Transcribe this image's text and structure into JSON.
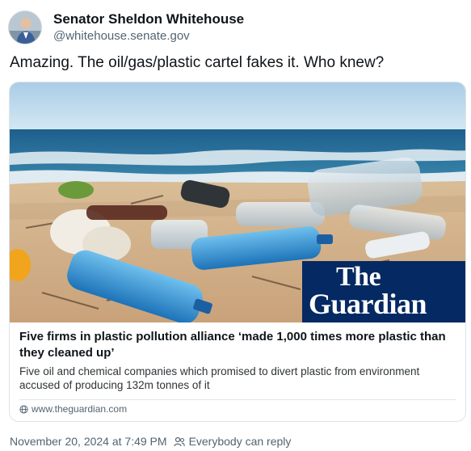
{
  "author": {
    "name": "Senator Sheldon Whitehouse",
    "handle": "@whitehouse.senate.gov"
  },
  "post": {
    "text": "Amazing. The oil/gas/plastic cartel fakes it. Who knew?"
  },
  "link_card": {
    "image_alt_icon": "plastic-bottles-on-beach-photo",
    "logo_line1": "The",
    "logo_line2": "Guardian",
    "title": "Five firms in plastic pollution alliance ‘made 1,000 times more plastic than they cleaned up’",
    "description": "Five oil and chemical companies which promised to divert plastic from environment accused of producing 132m tonnes of it",
    "source": "www.theguardian.com"
  },
  "footer": {
    "timestamp": "November 20, 2024 at 7:49 PM",
    "reply_setting": "Everybody can reply"
  },
  "colors": {
    "guardian_blue": "#052962",
    "muted_text": "#536471"
  }
}
